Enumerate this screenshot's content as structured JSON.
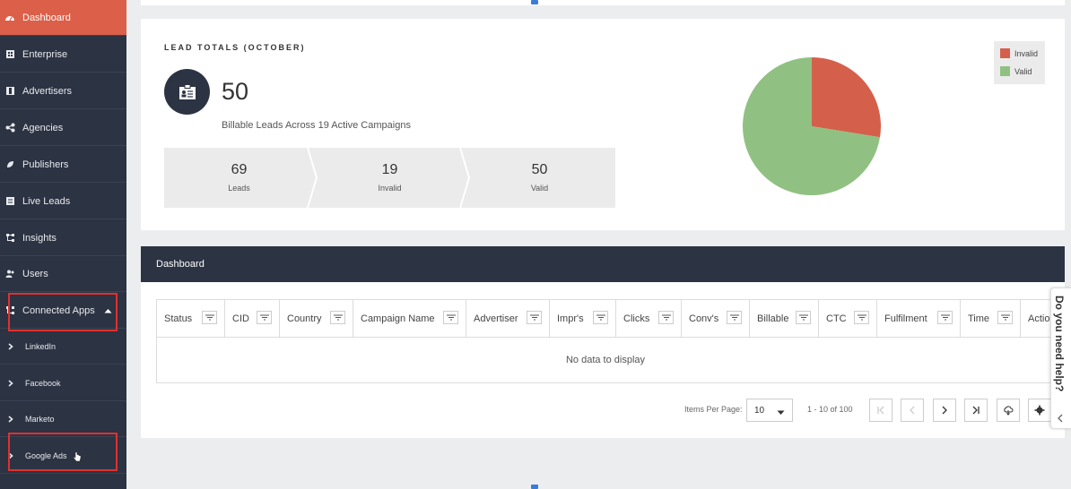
{
  "sidebar": {
    "items": [
      {
        "label": "Dashboard",
        "icon": "dashboard-icon"
      },
      {
        "label": "Enterprise",
        "icon": "building-icon"
      },
      {
        "label": "Advertisers",
        "icon": "advertiser-icon"
      },
      {
        "label": "Agencies",
        "icon": "share-icon"
      },
      {
        "label": "Publishers",
        "icon": "publisher-icon"
      },
      {
        "label": "Live Leads",
        "icon": "live-leads-icon"
      },
      {
        "label": "Insights",
        "icon": "insights-icon"
      },
      {
        "label": "Users",
        "icon": "users-icon"
      },
      {
        "label": "Connected Apps",
        "icon": "apps-icon"
      }
    ],
    "subitems": [
      {
        "label": "LinkedIn"
      },
      {
        "label": "Facebook"
      },
      {
        "label": "Marketo"
      },
      {
        "label": "Google Ads"
      }
    ]
  },
  "lead_totals": {
    "title": "LEAD TOTALS (OCTOBER)",
    "billable_count": "50",
    "billable_subtitle": "Billable Leads Across 19 Active Campaigns",
    "stats": [
      {
        "value": "69",
        "label": "Leads"
      },
      {
        "value": "19",
        "label": "Invalid"
      },
      {
        "value": "50",
        "label": "Valid"
      }
    ]
  },
  "chart_data": {
    "type": "pie",
    "categories": [
      "Invalid",
      "Valid"
    ],
    "values": [
      19,
      50
    ],
    "colors": [
      "#d4604b",
      "#90c183"
    ],
    "legend_position": "top-right"
  },
  "dashboard": {
    "title": "Dashboard",
    "columns": [
      "Status",
      "CID",
      "Country",
      "Campaign Name",
      "Advertiser",
      "Impr's",
      "Clicks",
      "Conv's",
      "Billable",
      "CTC",
      "Fulfilment",
      "Time",
      "Action"
    ],
    "empty_message": "No data to display"
  },
  "pagination": {
    "items_per_page_label": "Items Per Page:",
    "items_per_page": "10",
    "range": "1 - 10 of 100"
  },
  "help": {
    "label": "Do you need help?"
  }
}
